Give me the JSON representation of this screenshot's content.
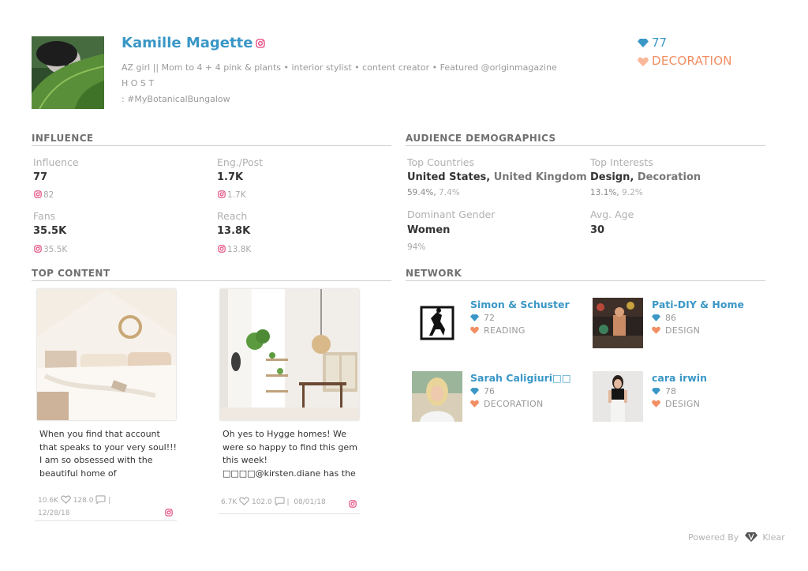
{
  "profile": {
    "name": "Kamille Magette",
    "bio_line1": "AZ girl || Mom to 4 + 4 pink & plants • interior stylist • content creator • Featured @originmagazine H O S T",
    "bio_line2": ": #MyBotanicalBungalow",
    "score": "77",
    "category": "DECORATION"
  },
  "influence": {
    "title": "INFLUENCE",
    "influence_label": "Influence",
    "influence_value": "77",
    "influence_sub": "82",
    "eng_label": "Eng./Post",
    "eng_value": "1.7K",
    "eng_sub": "1.7K",
    "fans_label": "Fans",
    "fans_value": "35.5K",
    "fans_sub": "35.5K",
    "reach_label": "Reach",
    "reach_value": "13.8K",
    "reach_sub": "13.8K"
  },
  "audience": {
    "title": "AUDIENCE DEMOGRAPHICS",
    "countries_label": "Top Countries",
    "country_1": "United States,",
    "country_2": "United Kingdom",
    "country_pct_1": "59.4%,",
    "country_pct_2": "7.4%",
    "interests_label": "Top Interests",
    "interest_1": "Design,",
    "interest_2": "Decoration",
    "interest_pct_1": "13.1%,",
    "interest_pct_2": "9.2%",
    "gender_label": "Dominant Gender",
    "gender_value": "Women",
    "gender_pct": "94%",
    "age_label": "Avg. Age",
    "age_value": "30"
  },
  "top_content": {
    "title": "TOP CONTENT",
    "posts": [
      {
        "text": "When you find that account that speaks to your very soul!!! I am so obsessed with the beautiful home of @lovesarahschneider □□□",
        "likes": "10.6K",
        "comments": "128.0",
        "date": "12/28/18"
      },
      {
        "text": "Oh yes to Hygge homes! We were so happy to find this gem this week! □□□□@kirsten.diane has the most beautiful home, light",
        "likes": "6.7K",
        "comments": "102.0",
        "date": "08/01/18"
      }
    ]
  },
  "network": {
    "title": "NETWORK",
    "items": [
      {
        "name": "Simon & Schuster",
        "score": "72",
        "category": "READING"
      },
      {
        "name": "Pati-DIY & Home",
        "score": "86",
        "category": "DESIGN"
      },
      {
        "name": "Sarah Caligiuri□□",
        "score": "76",
        "category": "DECORATION"
      },
      {
        "name": "cara irwin",
        "score": "78",
        "category": "DESIGN"
      }
    ]
  },
  "footer": {
    "powered_by": "Powered By",
    "brand": "Klear"
  },
  "colors": {
    "accent_blue": "#3a97c6",
    "accent_orange": "#f28e63",
    "instagram_pink": "#e4407a"
  }
}
